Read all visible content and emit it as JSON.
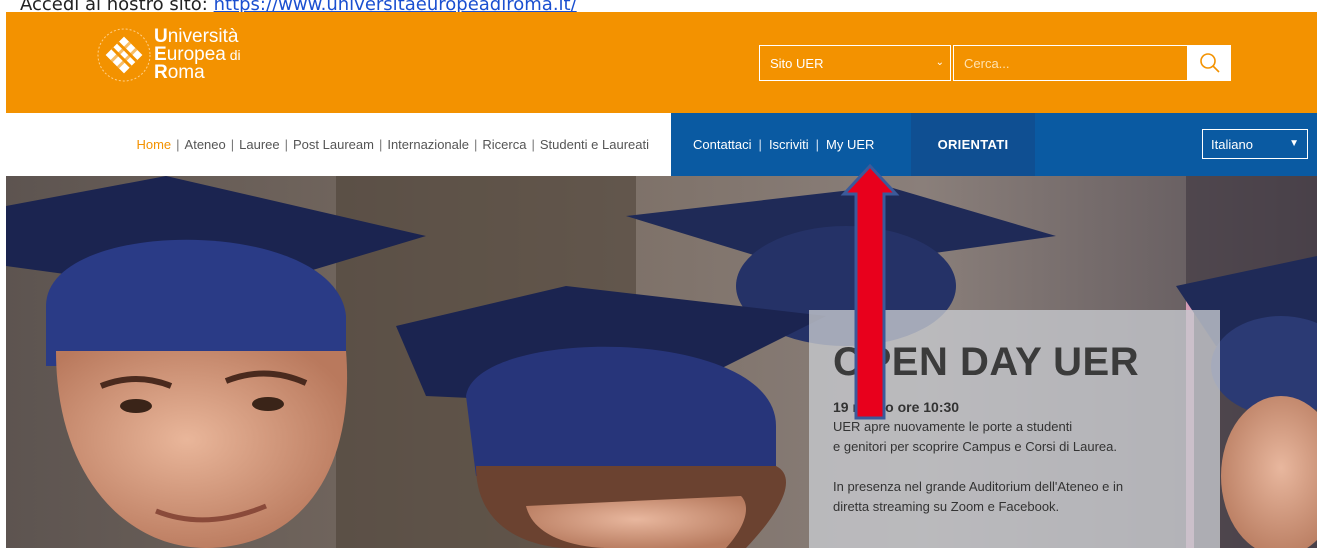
{
  "caption": {
    "prefix": "Accedi al nostro sito: ",
    "link": "https://www.universitaeuropeadiroma.it/"
  },
  "logo": {
    "letter1": "U",
    "word1": "niversità",
    "letter2": "E",
    "word2": "uropea",
    "di": " di",
    "letter3": "R",
    "word3": "oma"
  },
  "search": {
    "scope": "Sito UER",
    "placeholder": "Cerca..."
  },
  "nav_main": [
    {
      "label": "Home",
      "active": true
    },
    {
      "label": "Ateneo"
    },
    {
      "label": "Lauree"
    },
    {
      "label": "Post Lauream"
    },
    {
      "label": "Internazionale"
    },
    {
      "label": "Ricerca"
    },
    {
      "label": "Studenti e Laureati"
    }
  ],
  "nav_secondary": {
    "contattaci": "Contattaci",
    "iscriviti": "Iscriviti",
    "myuer": "My UER",
    "orientati": "ORIENTATI",
    "language": "Italiano"
  },
  "promo": {
    "title": "OPEN DAY UER",
    "date": "19 marzo ore 10:30",
    "line1": "UER apre nuovamente le porte a studenti",
    "line2": "e genitori per scoprire Campus e Corsi di Laurea.",
    "line3": "In presenza nel grande Auditorium dell'Ateneo e in",
    "line4": "diretta streaming su Zoom e Facebook."
  },
  "colors": {
    "header_orange": "#f39200",
    "nav_blue": "#0a5aa2",
    "arrow_red": "#e8001c"
  }
}
